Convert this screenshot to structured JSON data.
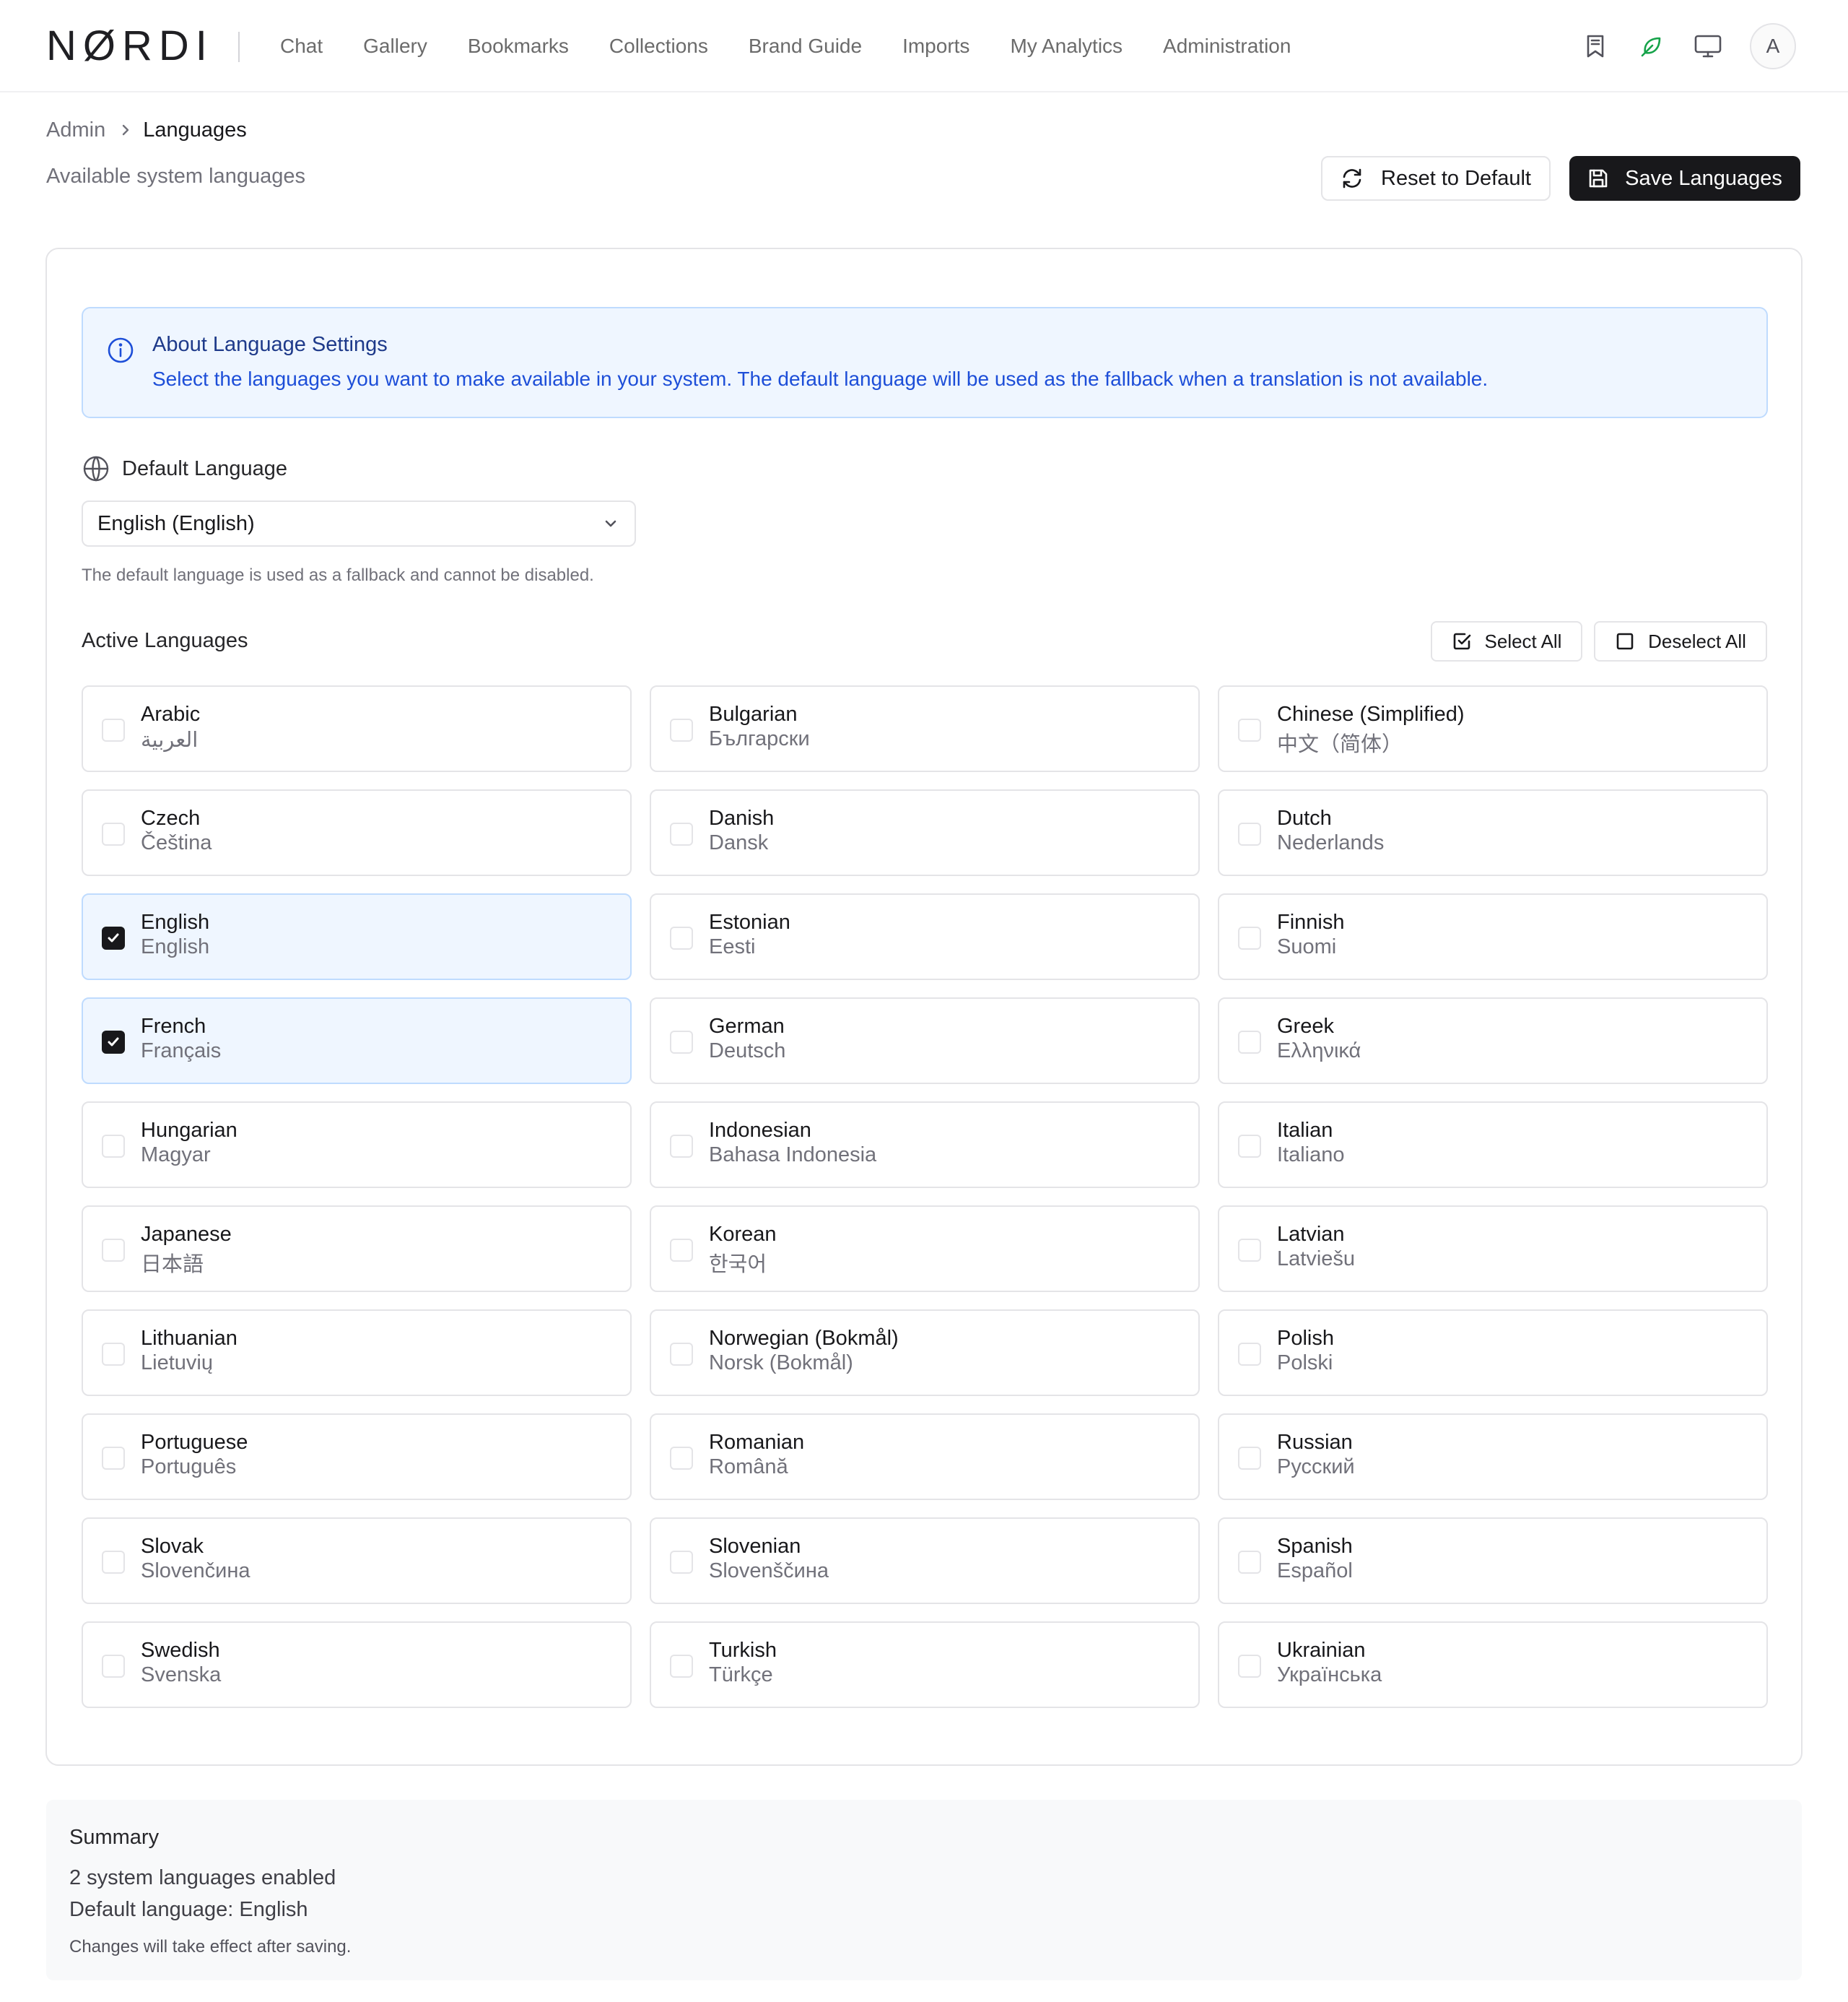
{
  "app": {
    "logo": "NØRDI"
  },
  "nav": {
    "items": [
      {
        "label": "Chat"
      },
      {
        "label": "Gallery"
      },
      {
        "label": "Bookmarks"
      },
      {
        "label": "Collections"
      },
      {
        "label": "Brand Guide"
      },
      {
        "label": "Imports"
      },
      {
        "label": "My Analytics"
      },
      {
        "label": "Administration"
      }
    ],
    "icons": [
      "bookmark-icon",
      "leaf-icon",
      "monitor-icon"
    ],
    "avatar_initial": "A"
  },
  "breadcrumb": {
    "root": "Admin",
    "current": "Languages"
  },
  "page": {
    "subtitle": "Available system languages"
  },
  "actions": {
    "reset_label": "Reset to Default",
    "save_label": "Save Languages"
  },
  "info": {
    "title": "About Language Settings",
    "text": "Select the languages you want to make available in your system. The default language will be used as the fallback when a translation is not available."
  },
  "default_language": {
    "label": "Default Language",
    "selected": "English (English)",
    "hint": "The default language is used as a fallback and cannot be disabled."
  },
  "active_languages": {
    "title": "Active Languages",
    "select_all_label": "Select All",
    "deselect_all_label": "Deselect All",
    "items": [
      {
        "name": "Arabic",
        "native": "العربية",
        "checked": false
      },
      {
        "name": "Bulgarian",
        "native": "Български",
        "checked": false
      },
      {
        "name": "Chinese (Simplified)",
        "native": "中文（简体）",
        "checked": false
      },
      {
        "name": "Czech",
        "native": "Čeština",
        "checked": false
      },
      {
        "name": "Danish",
        "native": "Dansk",
        "checked": false
      },
      {
        "name": "Dutch",
        "native": "Nederlands",
        "checked": false
      },
      {
        "name": "English",
        "native": "English",
        "checked": true
      },
      {
        "name": "Estonian",
        "native": "Eesti",
        "checked": false
      },
      {
        "name": "Finnish",
        "native": "Suomi",
        "checked": false
      },
      {
        "name": "French",
        "native": "Français",
        "checked": true
      },
      {
        "name": "German",
        "native": "Deutsch",
        "checked": false
      },
      {
        "name": "Greek",
        "native": "Ελληνικά",
        "checked": false
      },
      {
        "name": "Hungarian",
        "native": "Magyar",
        "checked": false
      },
      {
        "name": "Indonesian",
        "native": "Bahasa Indonesia",
        "checked": false
      },
      {
        "name": "Italian",
        "native": "Italiano",
        "checked": false
      },
      {
        "name": "Japanese",
        "native": "日本語",
        "checked": false
      },
      {
        "name": "Korean",
        "native": "한국어",
        "checked": false
      },
      {
        "name": "Latvian",
        "native": "Latviešu",
        "checked": false
      },
      {
        "name": "Lithuanian",
        "native": "Lietuvių",
        "checked": false
      },
      {
        "name": "Norwegian (Bokmål)",
        "native": "Norsk (Bokmål)",
        "checked": false
      },
      {
        "name": "Polish",
        "native": "Polski",
        "checked": false
      },
      {
        "name": "Portuguese",
        "native": "Português",
        "checked": false
      },
      {
        "name": "Romanian",
        "native": "Română",
        "checked": false
      },
      {
        "name": "Russian",
        "native": "Русский",
        "checked": false
      },
      {
        "name": "Slovak",
        "native": "Slovenčина",
        "checked": false
      },
      {
        "name": "Slovenian",
        "native": "Slovenščина",
        "checked": false
      },
      {
        "name": "Spanish",
        "native": "Español",
        "checked": false
      },
      {
        "name": "Swedish",
        "native": "Svenska",
        "checked": false
      },
      {
        "name": "Turkish",
        "native": "Türkçe",
        "checked": false
      },
      {
        "name": "Ukrainian",
        "native": "Українська",
        "checked": false
      }
    ]
  },
  "summary": {
    "title": "Summary",
    "enabled": "2 system languages enabled",
    "default": "Default language: English",
    "note": "Changes will take effect after saving."
  },
  "colors": {
    "primary": "#18181b",
    "info_bg": "#eff6ff",
    "info_border": "#bfdbfe",
    "info_text": "#1d4ed8",
    "leaf_icon": "#16a34a",
    "muted_text": "#71717a"
  }
}
